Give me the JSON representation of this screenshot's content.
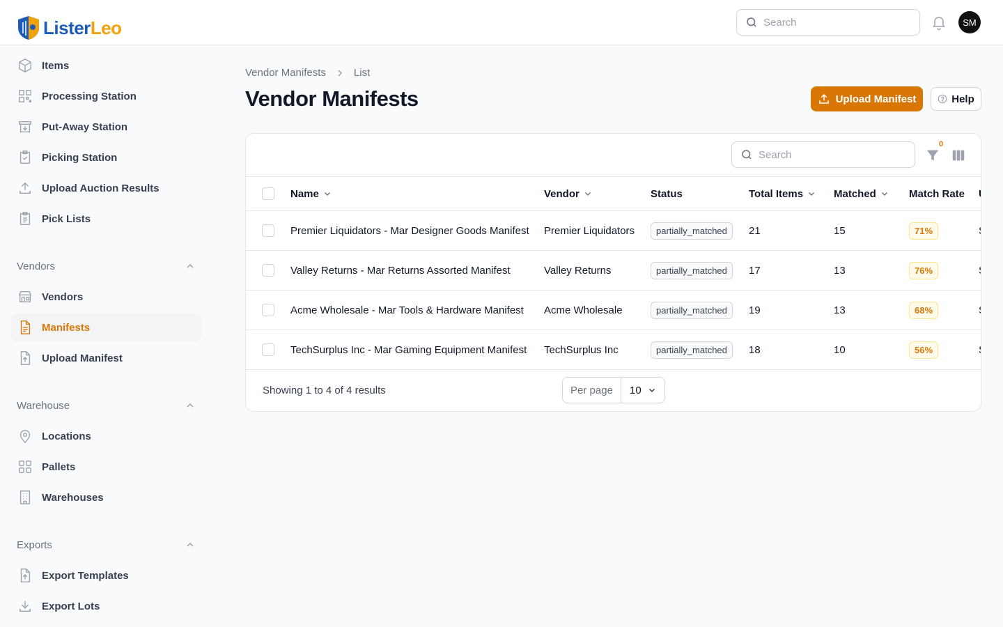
{
  "app": {
    "logo_part1": "Lister",
    "logo_part2": "Leo"
  },
  "header": {
    "search_placeholder": "Search",
    "avatar_initials": "SM"
  },
  "sidebar": {
    "items": [
      {
        "label": "Items",
        "icon": "cube-icon"
      },
      {
        "label": "Processing Station",
        "icon": "qr-code-icon"
      },
      {
        "label": "Put-Away Station",
        "icon": "archive-in-icon"
      },
      {
        "label": "Picking Station",
        "icon": "clipboard-check-icon"
      },
      {
        "label": "Upload Auction Results",
        "icon": "upload-icon"
      },
      {
        "label": "Pick Lists",
        "icon": "clipboard-list-icon"
      }
    ],
    "groups": [
      {
        "title": "Vendors",
        "items": [
          {
            "label": "Vendors",
            "icon": "storefront-icon"
          },
          {
            "label": "Manifests",
            "icon": "document-text-icon",
            "active": true
          },
          {
            "label": "Upload Manifest",
            "icon": "document-upload-icon"
          }
        ]
      },
      {
        "title": "Warehouse",
        "items": [
          {
            "label": "Locations",
            "icon": "map-pin-icon"
          },
          {
            "label": "Pallets",
            "icon": "grid-icon"
          },
          {
            "label": "Warehouses",
            "icon": "building-icon"
          }
        ]
      },
      {
        "title": "Exports",
        "items": [
          {
            "label": "Export Templates",
            "icon": "document-upload-icon"
          },
          {
            "label": "Export Lots",
            "icon": "download-icon"
          }
        ]
      }
    ]
  },
  "breadcrumb": {
    "parent": "Vendor Manifests",
    "current": "List"
  },
  "page": {
    "title": "Vendor Manifests",
    "upload_label": "Upload Manifest",
    "help_label": "Help"
  },
  "table": {
    "search_placeholder": "Search",
    "filter_count": "0",
    "columns": [
      "Name",
      "Vendor",
      "Status",
      "Total Items",
      "Matched",
      "Match Rate",
      "U"
    ],
    "rows": [
      {
        "name": "Premier Liquidators - Mar Designer Goods Manifest",
        "vendor": "Premier Liquidators",
        "status": "partially_matched",
        "total": "21",
        "matched": "15",
        "rate": "71%",
        "extra": "S"
      },
      {
        "name": "Valley Returns - Mar Returns Assorted Manifest",
        "vendor": "Valley Returns",
        "status": "partially_matched",
        "total": "17",
        "matched": "13",
        "rate": "76%",
        "extra": "S"
      },
      {
        "name": "Acme Wholesale - Mar Tools & Hardware Manifest",
        "vendor": "Acme Wholesale",
        "status": "partially_matched",
        "total": "19",
        "matched": "13",
        "rate": "68%",
        "extra": "S"
      },
      {
        "name": "TechSurplus Inc - Mar Gaming Equipment Manifest",
        "vendor": "TechSurplus Inc",
        "status": "partially_matched",
        "total": "18",
        "matched": "10",
        "rate": "56%",
        "extra": "S"
      }
    ],
    "footer": "Showing 1 to 4 of 4 results",
    "per_page_label": "Per page",
    "per_page_value": "10"
  },
  "colors": {
    "accent": "#d97706",
    "brand_blue": "#1e5bb8",
    "brand_gold": "#f0a30a"
  }
}
